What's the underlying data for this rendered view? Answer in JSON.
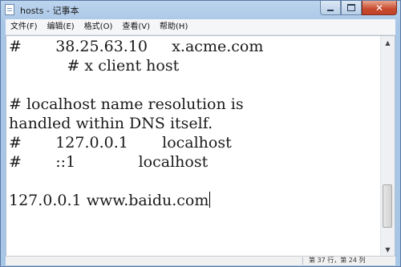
{
  "window": {
    "title": "hosts - 记事本",
    "minimize_label": "_",
    "maximize_label": "□",
    "close_label": "✕"
  },
  "menu": [
    {
      "label": "文件(F)"
    },
    {
      "label": "编辑(E)"
    },
    {
      "label": "格式(O)"
    },
    {
      "label": "查看(V)"
    },
    {
      "label": "帮助(H)"
    }
  ],
  "editor": {
    "lines": [
      "#       38.25.63.10     x.acme.com",
      "            # x client host",
      "",
      "# localhost name resolution is",
      "handled within DNS itself.",
      "#       127.0.0.1       localhost",
      "#       ::1             localhost",
      "",
      "127.0.0.1 www.baidu.com"
    ]
  },
  "status": {
    "position": "第 37 行，第 24 列"
  },
  "icons": {
    "app": "notepad-icon",
    "scroll_up": "arrow-up-icon",
    "scroll_down": "arrow-down-icon"
  }
}
